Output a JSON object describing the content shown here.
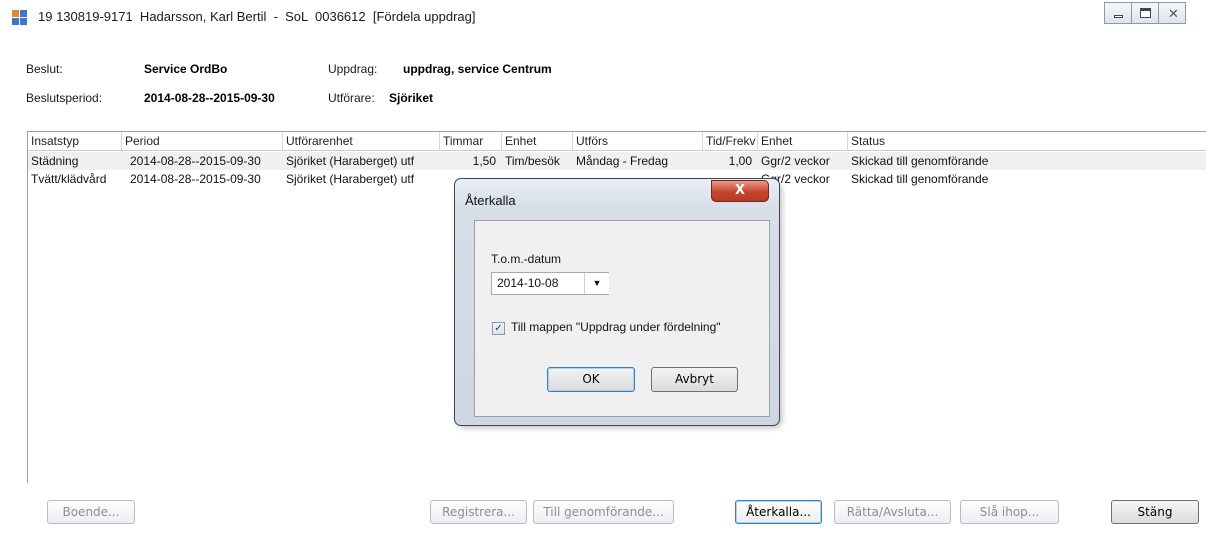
{
  "window": {
    "title": "19 130819-9171  Hadarsson, Karl Bertil  -  SoL  0036612  [Fördela uppdrag]",
    "controls": [
      "minimize",
      "maximize",
      "close"
    ],
    "close_glyph": "✕"
  },
  "info": {
    "beslut_label": "Beslut:",
    "beslut_value": "Service OrdBo",
    "uppdrag_label": "Uppdrag:",
    "uppdrag_value": "uppdrag, service Centrum",
    "beslutsperiod_label": "Beslutsperiod:",
    "beslutsperiod_value": "2014-08-28--2015-09-30",
    "utforare_label": "Utförare:",
    "utforare_value": "Sjöriket"
  },
  "grid": {
    "columns": [
      "Insatstyp",
      "Period",
      "Utförarenhet",
      "Timmar",
      "Enhet",
      "Utförs",
      "Tid/Frekv",
      "Enhet",
      "Status"
    ],
    "rows": [
      {
        "insatstyp": "Städning",
        "period": "2014-08-28--2015-09-30",
        "utforarenhet": "Sjöriket (Haraberget) utf",
        "timmar": "1,50",
        "enhet": "Tim/besök",
        "utfors": "Måndag - Fredag",
        "tid_frekv": "1,00",
        "enhet2": "Ggr/2 veckor",
        "status": "Skickad till genomförande",
        "selected": true
      },
      {
        "insatstyp": "Tvätt/klädvård",
        "period": "2014-08-28--2015-09-30",
        "utforarenhet": "Sjöriket (Haraberget) utf",
        "timmar": "",
        "enhet": "",
        "utfors": "",
        "tid_frekv": "",
        "enhet2": "Ggr/2 veckor",
        "status": "Skickad till genomförande",
        "selected": false
      }
    ]
  },
  "buttons": {
    "boende": "Boende...",
    "registrera": "Registrera...",
    "till_genomforande": "Till genomförande...",
    "aterkalla": "Återkalla...",
    "ratta_avsluta": "Rätta/Avsluta...",
    "sla_ihop": "Slå ihop...",
    "stang": "Stäng"
  },
  "dialog": {
    "title": "Återkalla",
    "close_glyph": "X",
    "date_label": "T.o.m.-datum",
    "date_value": "2014-10-08",
    "dropdown_glyph": "▼",
    "checkbox_checked": true,
    "checkbox_glyph": "✓",
    "checkbox_label": "Till mappen \"Uppdrag under fördelning\"",
    "ok_label": "OK",
    "cancel_label": "Avbryt"
  }
}
